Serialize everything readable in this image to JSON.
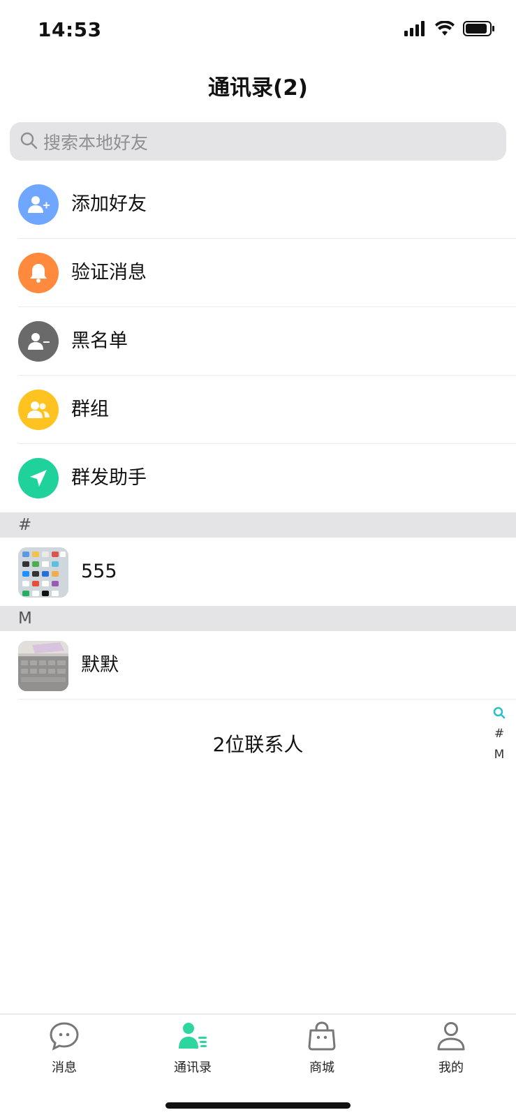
{
  "status": {
    "time": "14:53"
  },
  "title": "通讯录(2)",
  "search": {
    "placeholder": "搜索本地好友"
  },
  "menu": [
    {
      "label": "添加好友",
      "icon": "add-friend-icon",
      "color": "#6fa6ff"
    },
    {
      "label": "验证消息",
      "icon": "bell-icon",
      "color": "#ff8a3d"
    },
    {
      "label": "黑名单",
      "icon": "blocked-user-icon",
      "color": "#6a6a6a"
    },
    {
      "label": "群组",
      "icon": "group-icon",
      "color": "#ffc321"
    },
    {
      "label": "群发助手",
      "icon": "send-icon",
      "color": "#1fd19a"
    }
  ],
  "sections": [
    {
      "letter": "#",
      "contacts": [
        {
          "name": "555"
        }
      ]
    },
    {
      "letter": "M",
      "contacts": [
        {
          "name": "默默"
        }
      ]
    }
  ],
  "contact_count": "2位联系人",
  "index": [
    "#",
    "M"
  ],
  "tabs": [
    {
      "label": "消息",
      "icon": "chat-bubble-icon",
      "active": false
    },
    {
      "label": "通讯录",
      "icon": "contacts-icon",
      "active": true
    },
    {
      "label": "商城",
      "icon": "shopping-bag-icon",
      "active": false
    },
    {
      "label": "我的",
      "icon": "person-icon",
      "active": false
    }
  ],
  "colors": {
    "accent": "#2dd69f",
    "index_search": "#2bbfc5"
  }
}
